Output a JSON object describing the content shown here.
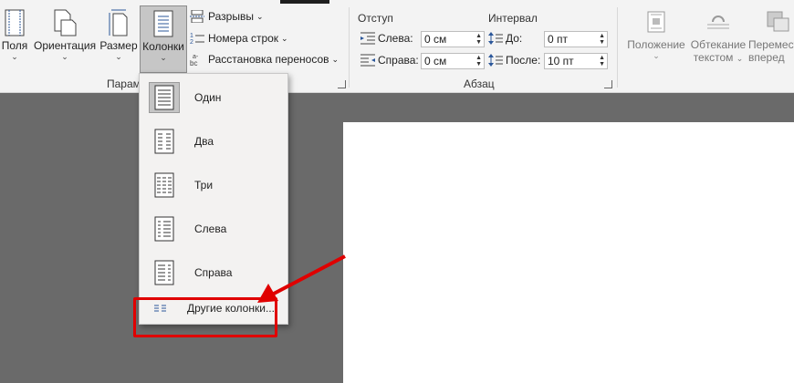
{
  "ribbon": {
    "buttons": {
      "margins": "Поля",
      "orientation": "Ориентация",
      "size": "Размер",
      "columns": "Колонки",
      "position": "Положение",
      "wrap_text_line1": "Обтекание",
      "wrap_text_line2": "текстом",
      "bring_forward_line1": "Перемест",
      "bring_forward_line2": "вперед"
    },
    "page_setup": {
      "breaks": "Разрывы",
      "line_numbers": "Номера строк",
      "hyphenation": "Расстановка переносов",
      "group_label": "Парам"
    },
    "paragraph": {
      "indent_title": "Отступ",
      "spacing_title": "Интервал",
      "left_label": "Слева:",
      "right_label": "Справа:",
      "before_label": "До:",
      "after_label": "После:",
      "left_value": "0 см",
      "right_value": "0 см",
      "before_value": "0 пт",
      "after_value": "10 пт",
      "group_label": "Абзац"
    }
  },
  "columns_menu": {
    "items": [
      {
        "label": "Один"
      },
      {
        "label": "Два"
      },
      {
        "label": "Три"
      },
      {
        "label": "Слева"
      },
      {
        "label": "Справа"
      }
    ],
    "more": "Другие колонки..."
  },
  "colors": {
    "highlight": "#e00000",
    "ribbon": "#f3f3f3",
    "background": "#6a6a6a",
    "accent": "#2b579a"
  }
}
